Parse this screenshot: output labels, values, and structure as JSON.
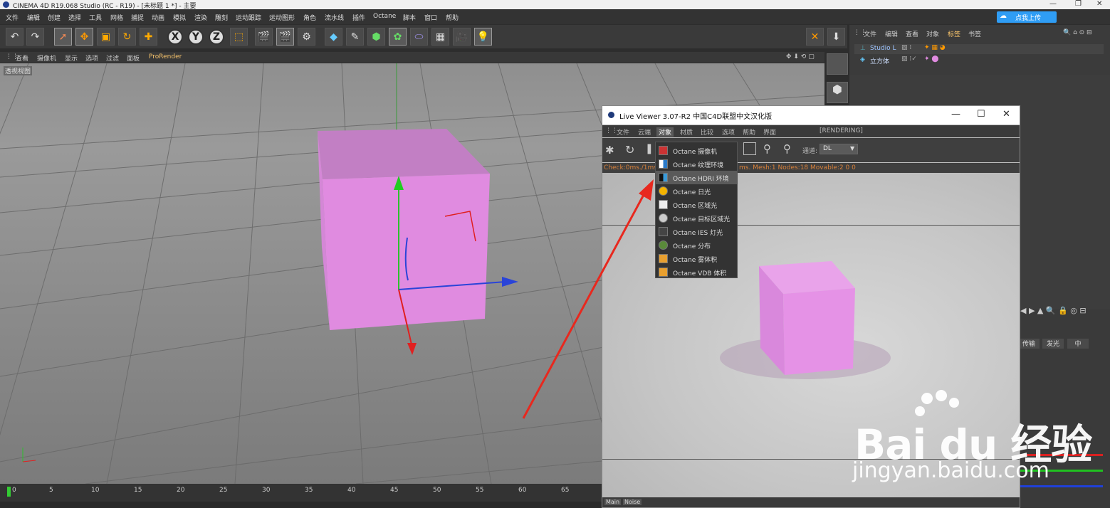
{
  "window": {
    "title": "CINEMA 4D R19.068 Studio (RC - R19) - [未标题 1 *] - 主要"
  },
  "menubar": [
    "文件",
    "编辑",
    "创建",
    "选择",
    "工具",
    "网格",
    "捕捉",
    "动画",
    "模拟",
    "渲染",
    "雕刻",
    "运动跟踪",
    "运动图形",
    "角色",
    "流水线",
    "插件",
    "Octane",
    "脚本",
    "窗口",
    "帮助"
  ],
  "upload_badge": {
    "label": "点我上传"
  },
  "viewport_menu": [
    "查看",
    "摄像机",
    "显示",
    "选项",
    "过滤",
    "面板",
    "ProRender"
  ],
  "viewport_label": "透视视图",
  "object_manager": {
    "menu": [
      "文件",
      "编辑",
      "查看",
      "对象",
      "标签",
      "书签"
    ],
    "objects": [
      {
        "name": "Studio L"
      },
      {
        "name": "立方体"
      }
    ]
  },
  "attribute_buttons": [
    "传输",
    "发光",
    "中"
  ],
  "timeline": {
    "ticks": [
      "0",
      "5",
      "10",
      "15",
      "20",
      "25",
      "30",
      "35",
      "40",
      "45",
      "50",
      "55",
      "60",
      "65"
    ]
  },
  "live_viewer": {
    "title": "Live Viewer 3.07-R2 中国C4D联盟中文汉化版",
    "menu": [
      "文件",
      "云端",
      "对象",
      "材质",
      "比较",
      "选项",
      "帮助",
      "界面"
    ],
    "rendering_status": "[RENDERING]",
    "channel_label": "通道:",
    "channel_value": "DL",
    "status_left": "Check:0ms./1ms.",
    "status_right": "ms. Mesh:1 Nodes:18 Movable:2 0 0",
    "bottom_tabs": [
      "Main",
      "Noise"
    ]
  },
  "dropdown": {
    "items": [
      {
        "label": "Octane 摄像机",
        "icon": "camera-icon",
        "selected": false
      },
      {
        "label": "Octane 纹理环境",
        "icon": "texture-env-icon",
        "selected": false
      },
      {
        "label": "Octane HDRI 环境",
        "icon": "hdri-env-icon",
        "selected": true
      },
      {
        "label": "Octane 日光",
        "icon": "sun-icon",
        "selected": false
      },
      {
        "label": "Octane 区域光",
        "icon": "area-light-icon",
        "selected": false
      },
      {
        "label": "Octane 目标区域光",
        "icon": "target-area-light-icon",
        "selected": false
      },
      {
        "label": "Octane IES 灯光",
        "icon": "ies-light-icon",
        "selected": false
      },
      {
        "label": "Octane 分布",
        "icon": "scatter-icon",
        "selected": false
      },
      {
        "label": "Octane 雾体积",
        "icon": "fog-volume-icon",
        "selected": false
      },
      {
        "label": "Octane VDB 体积",
        "icon": "vdb-volume-icon",
        "selected": false
      }
    ]
  },
  "watermark": {
    "brand": "Bai du 经验",
    "url": "jingyan.baidu.com"
  },
  "colors": {
    "cube": "#e08be0",
    "arrow": "#e8281e",
    "accent_orange": "#d8803a"
  }
}
